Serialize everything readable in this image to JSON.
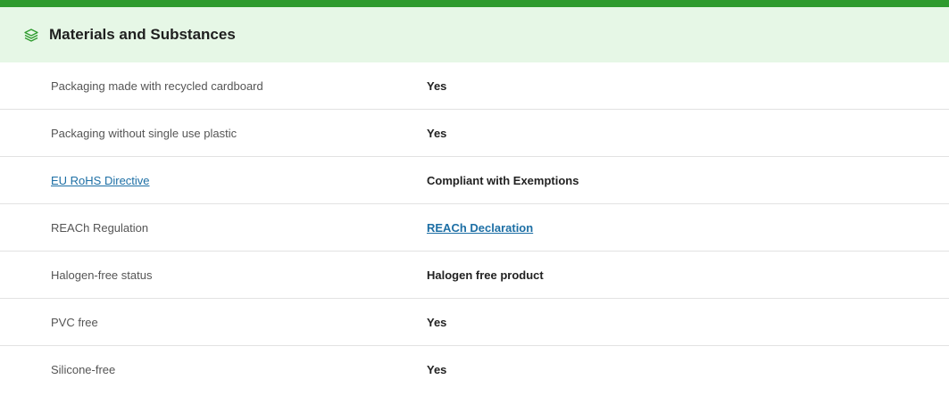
{
  "section": {
    "title": "Materials and Substances",
    "icon": "layers-icon",
    "accent_color": "#2e9b2e",
    "header_bg": "#e6f7e6",
    "link_color": "#1d6fa5"
  },
  "rows": [
    {
      "label": "Packaging made with recycled cardboard",
      "value": "Yes"
    },
    {
      "label": "Packaging without single use plastic",
      "value": "Yes"
    },
    {
      "label": "EU RoHS Directive",
      "value": "Compliant with Exemptions"
    },
    {
      "label": "REACh Regulation",
      "value": "REACh Declaration"
    },
    {
      "label": "Halogen-free status",
      "value": "Halogen free product"
    },
    {
      "label": "PVC free",
      "value": "Yes"
    },
    {
      "label": "Silicone-free",
      "value": "Yes"
    }
  ]
}
